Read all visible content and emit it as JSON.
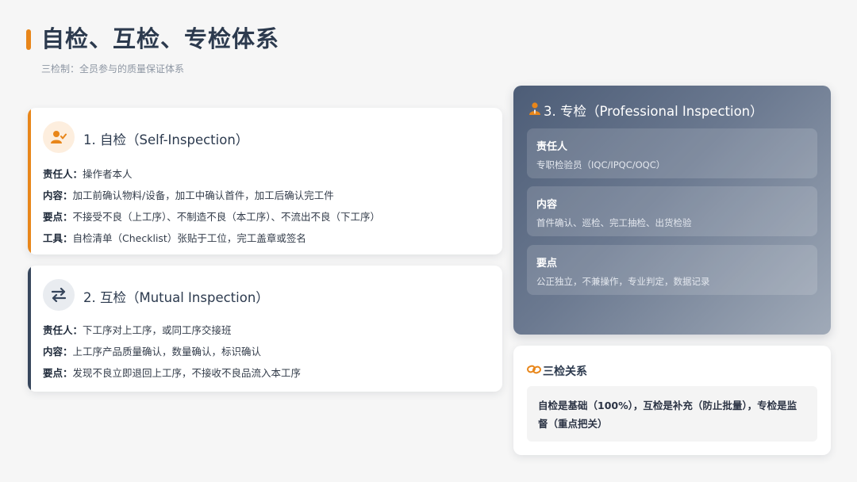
{
  "header": {
    "title": "自检、互检、专检体系",
    "subtitle": "三检制：全员参与的质量保证体系"
  },
  "colors": {
    "accent": "#e8861a",
    "dark": "#37465c",
    "text": "#2c3a4e"
  },
  "self_inspection": {
    "icon": "user-check-icon",
    "title": "1. 自检（Self-Inspection）",
    "rows": [
      {
        "label": "责任人：",
        "value": "操作者本人"
      },
      {
        "label": "内容：",
        "value": "加工前确认物料/设备，加工中确认首件，加工后确认完工件"
      },
      {
        "label": "要点：",
        "value": "不接受不良（上工序）、不制造不良（本工序）、不流出不良（下工序）"
      },
      {
        "label": "工具：",
        "value": "自检清单（Checklist）张贴于工位，完工盖章或签名"
      }
    ]
  },
  "mutual_inspection": {
    "icon": "exchange-arrows-icon",
    "title": "2. 互检（Mutual Inspection）",
    "rows": [
      {
        "label": "责任人：",
        "value": "下工序对上工序，或同工序交接班"
      },
      {
        "label": "内容：",
        "value": "上工序产品质量确认，数量确认，标识确认"
      },
      {
        "label": "要点：",
        "value": "发现不良立即退回上工序，不接收不良品流入本工序"
      }
    ]
  },
  "professional_inspection": {
    "icon": "user-tie-icon",
    "title": "3. 专检（Professional Inspection）",
    "boxes": [
      {
        "label": "责任人",
        "value": "专职检验员（IQC/IPQC/OQC）"
      },
      {
        "label": "内容",
        "value": "首件确认、巡检、完工抽检、出货检验"
      },
      {
        "label": "要点",
        "value": "公正独立，不兼操作，专业判定，数据记录"
      }
    ]
  },
  "relationship": {
    "icon": "link-icon",
    "title": "三检关系",
    "text": "自检是基础（100%），互检是补充（防止批量），专检是监督（重点把关）"
  }
}
